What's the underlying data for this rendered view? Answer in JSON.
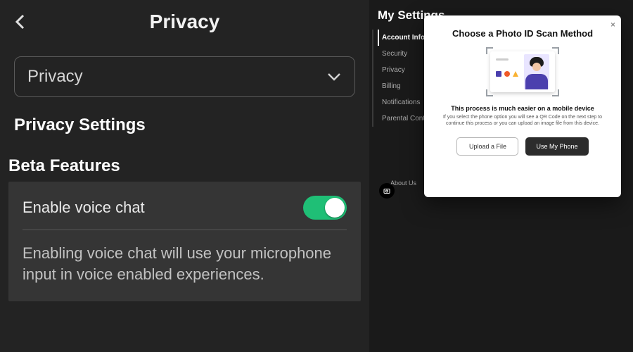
{
  "left": {
    "header_title": "Privacy",
    "dropdown_selected": "Privacy",
    "section_title": "Privacy Settings",
    "subsection_title": "Beta Features",
    "card": {
      "toggle_label": "Enable voice chat",
      "toggle_on": true,
      "description": "Enabling voice chat will use your microphone input in voice enabled experiences."
    }
  },
  "right": {
    "title": "My Settings",
    "nav": [
      {
        "label": "Account Info",
        "active": true
      },
      {
        "label": "Security",
        "active": false
      },
      {
        "label": "Privacy",
        "active": false
      },
      {
        "label": "Billing",
        "active": false
      },
      {
        "label": "Notifications",
        "active": false
      },
      {
        "label": "Parental Controls",
        "active": false
      }
    ],
    "footer": [
      "About Us"
    ]
  },
  "modal": {
    "title": "Choose a Photo ID Scan Method",
    "subtitle": "This process is much easier on a mobile device",
    "description": "If you select the phone option you will see a QR Code on the next step to continue this process or you can upload an image file from this device.",
    "upload_label": "Upload a File",
    "phone_label": "Use My Phone",
    "close_glyph": "×"
  }
}
